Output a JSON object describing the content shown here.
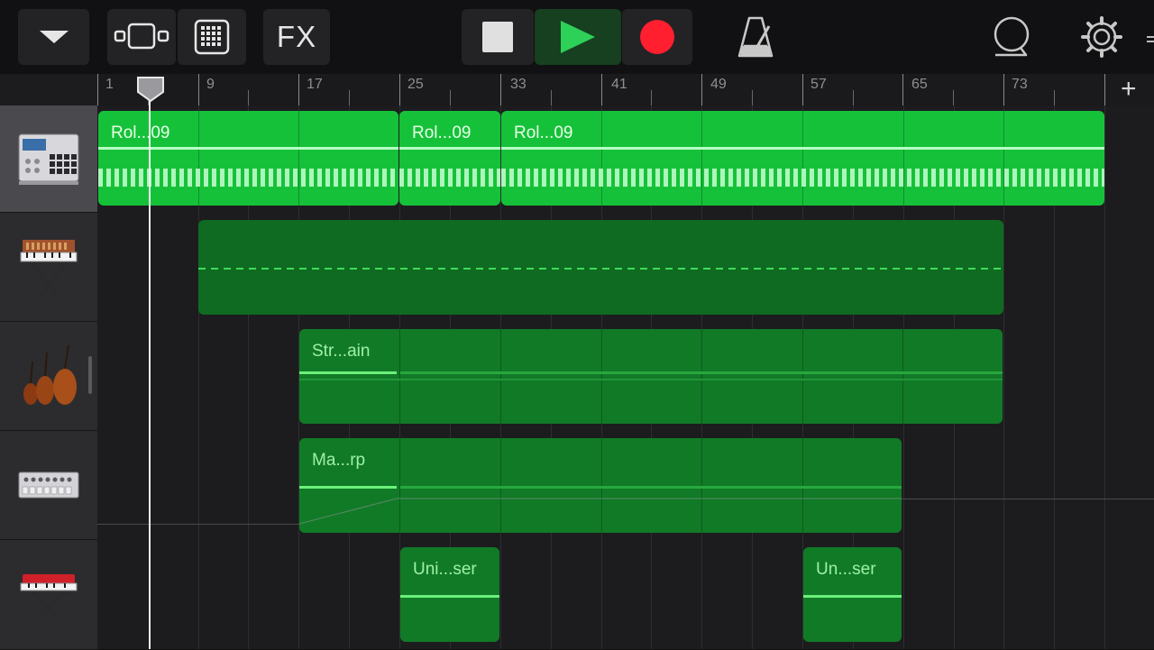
{
  "toolbar": {
    "menu_icon": "chevron-down-icon",
    "tracks_view_icon": "tracks-view-icon",
    "grid_icon": "grid-pads-icon",
    "fx_label": "FX",
    "stop_icon": "stop-icon",
    "play_icon": "play-icon",
    "record_icon": "record-icon",
    "metronome_icon": "metronome-icon",
    "loop_icon": "loop-browser-icon",
    "settings_icon": "gear-icon"
  },
  "ruler": {
    "bars": [
      "1",
      "9",
      "17",
      "25",
      "33",
      "41",
      "49",
      "57",
      "65",
      "73"
    ],
    "add_icon": "plus-icon",
    "add_label": "+"
  },
  "tracks": [
    {
      "instrument": "drum-machine-icon",
      "selected": true
    },
    {
      "instrument": "synth-keyboard-icon",
      "selected": false
    },
    {
      "instrument": "strings-icon",
      "selected": false
    },
    {
      "instrument": "drum-machine-silver-icon",
      "selected": false
    },
    {
      "instrument": "red-keyboard-icon",
      "selected": false
    }
  ],
  "regions": {
    "track1": [
      "Rol...09",
      "Rol...09",
      "Rol...09"
    ],
    "track3": [
      "Str...ain"
    ],
    "track4": [
      "Ma...rp"
    ],
    "track5": [
      "Uni...ser",
      "Un...ser"
    ]
  },
  "colors": {
    "region_bright": "#16c13a",
    "region_dark": "#0f6b22",
    "record_red": "#ff1f2e",
    "play_green": "#2ed158"
  }
}
